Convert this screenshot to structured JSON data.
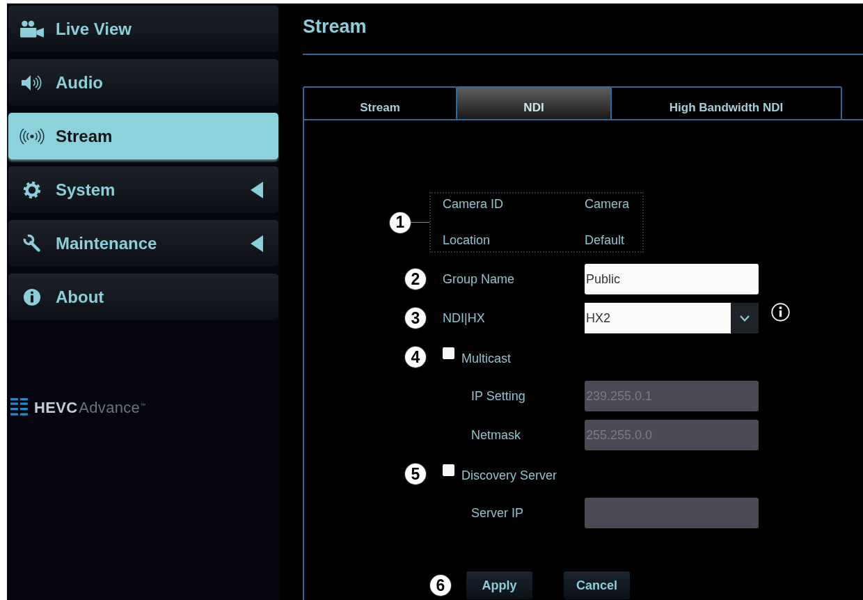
{
  "sidebar": {
    "items": [
      {
        "label": "Live View",
        "selected": false,
        "submenu": false
      },
      {
        "label": "Audio",
        "selected": false,
        "submenu": false
      },
      {
        "label": "Stream",
        "selected": true,
        "submenu": false
      },
      {
        "label": "System",
        "selected": false,
        "submenu": true
      },
      {
        "label": "Maintenance",
        "selected": false,
        "submenu": true
      },
      {
        "label": "About",
        "selected": false,
        "submenu": false
      }
    ],
    "logo": "**HEVC**Advance$^{™}$"
  },
  "header": {
    "title": "Stream"
  },
  "tabs": [
    {
      "label": "Stream",
      "selected": false
    },
    {
      "label": "NDI",
      "selected": true
    },
    {
      "label": "High Bandwidth NDI",
      "selected": false
    }
  ],
  "form": {
    "info_group": {
      "callout": "1",
      "rows": [
        {
          "label": "Camera ID",
          "value": "Camera"
        },
        {
          "label": "Location",
          "value": "Default"
        }
      ]
    },
    "rows": [
      {
        "kind": "input",
        "callout": "2",
        "label": "Group Name",
        "value": "Public",
        "disabled": false
      },
      {
        "kind": "select",
        "callout": "3",
        "label": "NDI|HX",
        "value": "HX2"
      },
      {
        "kind": "checkbox",
        "callout": "4",
        "label": "Multicast",
        "checked": false,
        "children": [
          {
            "kind": "input",
            "label": "IP Setting",
            "value": "239.255.0.1",
            "disabled": true
          },
          {
            "kind": "input",
            "label": "Netmask",
            "value": "255.255.0.0",
            "disabled": true
          }
        ]
      },
      {
        "kind": "checkbox",
        "callout": "5",
        "label": "Discovery Server",
        "checked": false,
        "children": [
          {
            "kind": "input",
            "label": "Server IP",
            "disabled": true
          }
        ]
      }
    ],
    "actions": {
      "callout": "6",
      "buttons": [
        "Apply",
        "Cancel"
      ]
    }
  }
}
